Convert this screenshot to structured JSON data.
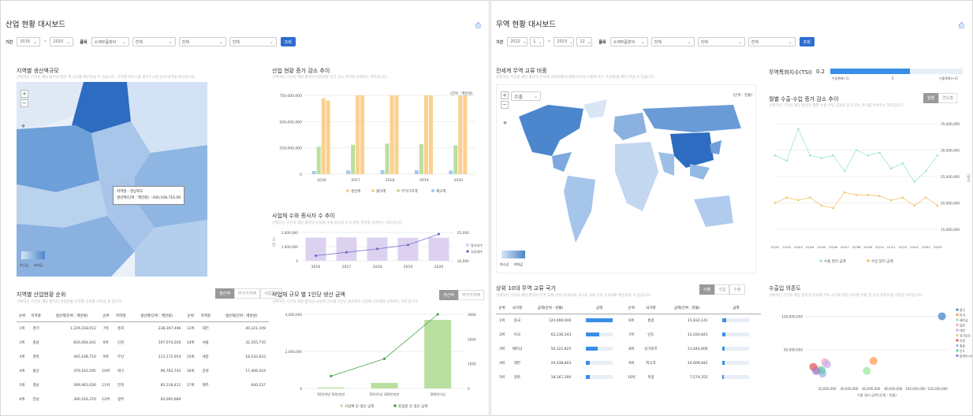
{
  "left": {
    "title": "산업 현황 대시보드",
    "filters": {
      "period_label": "기간",
      "from": "2016",
      "tilde": "~",
      "to": "2020",
      "cat_label": "품목",
      "cat1": "소재부품장비",
      "cat2": "전체",
      "cat3": "전체",
      "cat4": "전체",
      "search": "조회"
    },
    "regional": {
      "title": "지역별 생산액규모",
      "subtitle": "선택하신 기간의 해당 품목의 생산 액 규모를 확인하실 수 있습니다. 지역별 마우스를 올려두시면 상세 내역을 확인합니다.",
      "unit": "(단위 : 백만원)",
      "legend_min": "최소값",
      "legend_max": "최대값",
      "tooltip_region_label": "지역명",
      "tooltip_region": "경상북도",
      "tooltip_value_label": "생산액(단위 : 백만원)",
      "tooltip_value": "440,108,710.00"
    },
    "industry_change": {
      "title": "산업 현황 증가 감소 추이",
      "subtitle": "선택하신 기간의 해당 품목의 산업현황 증가 감소 추이를 보여주는 차트입니다.",
      "legend": [
        "생산액",
        "출하액",
        "부가가치액",
        "재고액"
      ]
    },
    "workers": {
      "title": "사업체 수와 종사자 수 추이",
      "subtitle": "선택하신 기간의 해당 품목의 사업체 수와 종사자 수의 변화 추이를 보여주는 차트입니다.",
      "legend": [
        "종사자수",
        "사업체수"
      ],
      "ylabel_left": "(명 수)",
      "ylabel_right": "(개 수)"
    },
    "ranking": {
      "title": "지역별 산업현황 순위",
      "subtitle": "선택하신 기간의 해당 품목의 산업현황 지역별 순위를 나타낸 표 입니다.",
      "tabs": [
        "생산액",
        "부가가치액",
        "사업체수"
      ],
      "headers": [
        "순위",
        "지역명",
        "생산액(단위 : 백만원)"
      ],
      "col1": [
        [
          "1위",
          "경기",
          "1,229,318,012"
        ],
        [
          "2위",
          "충남",
          "816,064,641"
        ],
        [
          "3위",
          "경북",
          "445,108,710"
        ],
        [
          "4위",
          "울산",
          "379,163,595"
        ],
        [
          "5위",
          "경남",
          "309,963,026"
        ],
        [
          "6위",
          "전남",
          "300,416,376"
        ]
      ],
      "col2": [
        [
          "7위",
          "충북",
          "238,397,496"
        ],
        [
          "8위",
          "인천",
          "197,074,200"
        ],
        [
          "9위",
          "부산",
          "113,172,954"
        ],
        [
          "10위",
          "대구",
          "90,762,745"
        ],
        [
          "11위",
          "전북",
          "85,318,411"
        ],
        [
          "12위",
          "광주",
          "65,095,689"
        ]
      ],
      "col3": [
        [
          "13위",
          "대전",
          "40,321,109"
        ],
        [
          "14위",
          "서울",
          "32,355,735"
        ],
        [
          "15위",
          "세종",
          "18,532,833"
        ],
        [
          "16위",
          "강원",
          "17,406,424"
        ],
        [
          "17위",
          "제주",
          "640,237"
        ]
      ]
    },
    "scale": {
      "title": "사업체 규모 별 1인당 생산 금액",
      "subtitle": "선택하신 기간의 해당 품목의 사업체 규모별 1인당 생산액과 사업체 규모별로 보여주는 차트입니다.",
      "tabs": [
        "생산액",
        "부가가치액"
      ],
      "legend": [
        "사업체 당 생산 금액",
        "종업원 당 생산 금액"
      ]
    },
    "colors": {
      "accent": "#2f6dd0",
      "map_dark": "#2d6cc0",
      "bar_orange": "#fbd08e",
      "bar_green": "#b9df9e",
      "bar_blue": "#a6c8ec",
      "bar_purple": "#dcd2f0",
      "line_purple": "#7d6fd0",
      "line_green": "#44a544"
    }
  },
  "right": {
    "title": "무역 현황 대시보드",
    "filters": {
      "period_label": "기간",
      "from_y": "2022",
      "from_m": "1",
      "tilde": "~",
      "to_y": "2023",
      "to_m": "12",
      "cat_label": "품목",
      "cat1": "소재부품장비",
      "cat2": "전체",
      "cat3": "전체",
      "cat4": "전체",
      "search": "조회"
    },
    "world": {
      "title": "전세계 무역 교류 비중",
      "subtitle": "선택하신 기간의 해당 품목의 전세계 교류현황(전세계 국가의 수출액 또는 수입액)을 확인 하실 수 있습니다.",
      "unit": "(단위 : 천불)",
      "mode": "수출",
      "legend_min": "최소값",
      "legend_max": "최대값"
    },
    "tsi": {
      "title": "무역특화지수(TSI)",
      "value": "0.2",
      "left": "수입특화(-1)",
      "mid": "0",
      "right": "수출특화(+1)",
      "fill_fraction": 0.6
    },
    "monthly": {
      "title": "월별 수출·수입 증가 감소 추이",
      "subtitle": "선택하신 기간의 해당 품목의 월별 수출 수입 금액의 증가 감소 추이를 보여주는 차트입니다.",
      "tabs": [
        "월별",
        "연도별"
      ],
      "legend": [
        "수출 달러 금액",
        "수입 달러 금액"
      ],
      "ylabel": "(달러)"
    },
    "top10": {
      "title": "상위 10대 무역 교류 국가",
      "subtitle": "선택하신 기간의 해당 품목의 무역 교류 상위 10개국을 국가의 교류 규모 순서대로 확인하실 수 있습니다.",
      "tabs": [
        "수출",
        "수입",
        "수출"
      ],
      "headers": [
        "순위",
        "국가명",
        "금액(단위 : 천불)",
        "금액"
      ],
      "col1": [
        [
          "1위",
          "중국",
          "124,006,040"
        ],
        [
          "2위",
          "미국",
          "62,236,343"
        ],
        [
          "3위",
          "베트남",
          "56,321,825"
        ],
        [
          "4위",
          "대만",
          "20,038,803"
        ],
        [
          "5위",
          "일본",
          "18,167,300"
        ]
      ],
      "col2": [
        [
          "6위",
          "홍콩",
          "15,832,141"
        ],
        [
          "7위",
          "인도",
          "15,030,841"
        ],
        [
          "8위",
          "싱가포르",
          "11,644,800"
        ],
        [
          "9위",
          "멕시코",
          "10,609,842"
        ],
        [
          "10위",
          "독일",
          "7,574,355"
        ]
      ],
      "fractions1": [
        1,
        0.5,
        0.45,
        0.16,
        0.15
      ],
      "fractions2": [
        0.13,
        0.12,
        0.09,
        0.085,
        0.06
      ]
    },
    "dependency": {
      "title": "수출입 의존도",
      "subtitle": "선택하신 기간의 해당 품목의 전세계 주요 국가에 대한 국가별 수출 및 수입 의존도를 나타낸 차트입니다.",
      "xlabel": "수출 달러 금액 (단위 : 천불)",
      "legend": [
        "중국",
        "미국",
        "베트남",
        "일본",
        "대만",
        "싱가포르",
        "독일",
        "홍콩",
        "인도",
        "말레이시아"
      ]
    },
    "colors": {
      "accent": "#2f6dd0",
      "export_line": "#9ee6d8",
      "import_line": "#f5c66d"
    }
  },
  "chart_data": [
    {
      "type": "bar",
      "title": "산업 현황 증가 감소 추이",
      "categories": [
        "2016",
        "2017",
        "2018",
        "2019",
        "2020"
      ],
      "ylim": [
        0,
        750000000
      ],
      "yticks": [
        "0",
        "250,000,000",
        "500,000,000",
        "750,000,000"
      ],
      "series": [
        {
          "name": "생산액",
          "values": [
            720000000,
            785000000,
            810000000,
            795000000,
            770000000
          ]
        },
        {
          "name": "출하액",
          "values": [
            700000000,
            770000000,
            800000000,
            785000000,
            755000000
          ]
        },
        {
          "name": "부가가치액",
          "values": [
            260000000,
            280000000,
            290000000,
            285000000,
            275000000
          ]
        },
        {
          "name": "재고액",
          "values": [
            30000000,
            35000000,
            38000000,
            36000000,
            34000000
          ]
        }
      ]
    },
    {
      "type": "bar",
      "title": "사업체 수와 종사자 수 추이",
      "categories": [
        "2016",
        "2017",
        "2018",
        "2019",
        "2020"
      ],
      "ylim": [
        0,
        2000000
      ],
      "yticks": [
        "0",
        "1,000,000",
        "2,000,000"
      ],
      "y2ticks": [
        "20,000",
        "25,000"
      ],
      "series": [
        {
          "name": "종사자수",
          "values": [
            1640000,
            1650000,
            1640000,
            1620000,
            1630000
          ]
        },
        {
          "name": "사업체수",
          "values": [
            20900,
            21500,
            22100,
            22800,
            24700
          ]
        }
      ]
    },
    {
      "type": "bar",
      "title": "사업체 규모 별 1인당 생산 금액",
      "categories": [
        "50인미만 50인미만",
        "50인이상 300인미만",
        "300인이상"
      ],
      "ylim": [
        0,
        4000000
      ],
      "yticks": [
        "0",
        "2,000,000",
        "4,000,000"
      ],
      "y2ticks": [
        "0",
        "1000",
        "2000",
        "3000"
      ],
      "series": [
        {
          "name": "사업체 당 생산 금액",
          "values": [
            50000,
            300000,
            3700000
          ]
        },
        {
          "name": "종업원 당 생산 금액",
          "values": [
            500,
            1200,
            3000
          ]
        }
      ]
    },
    {
      "type": "line",
      "title": "월별 수출·수입 증가 감소 추이",
      "categories": [
        "22/01",
        "22/02",
        "22/03",
        "22/04",
        "22/05",
        "22/06",
        "22/07",
        "22/08",
        "22/09",
        "22/10",
        "22/11",
        "22/12",
        "23/01",
        "23/02",
        "23/03"
      ],
      "ylim": [
        15000000,
        35000000
      ],
      "yticks": [
        "15,000,000",
        "20,000,000",
        "25,000,000",
        "30,000,000",
        "35,000,000"
      ],
      "series": [
        {
          "name": "수출 달러 금액",
          "values": [
            29000000,
            28000000,
            34000000,
            29000000,
            28500000,
            29000000,
            26000000,
            30000000,
            29000000,
            29500000,
            26500000,
            27500000,
            24000000,
            26000000,
            29000000
          ]
        },
        {
          "name": "수입 달러 금액",
          "values": [
            20000000,
            21000000,
            20500000,
            21000000,
            19500000,
            19000000,
            22000000,
            21500000,
            21500000,
            21300000,
            20500000,
            21000000,
            19500000,
            21000000,
            19500000
          ]
        }
      ]
    },
    {
      "type": "scatter",
      "title": "수출입 의존도",
      "xlabel": "수출 달러 금액 (단위 : 천불)",
      "xticks": [
        "20,000,000",
        "40,000,000",
        "60,000,000",
        "80,000,000",
        "100,000,000",
        "120,000,000"
      ],
      "yticks": [
        "50,000,000",
        "100,000,000"
      ],
      "points": [
        {
          "name": "중국",
          "x": 124000000,
          "y": 100000000
        },
        {
          "name": "미국",
          "x": 62000000,
          "y": 33000000
        },
        {
          "name": "베트남",
          "x": 56000000,
          "y": 18000000
        },
        {
          "name": "일본",
          "x": 18000000,
          "y": 31000000
        },
        {
          "name": "대만",
          "x": 20000000,
          "y": 28000000
        },
        {
          "name": "싱가포르",
          "x": 11600000,
          "y": 20000000
        },
        {
          "name": "독일",
          "x": 7500000,
          "y": 24000000
        },
        {
          "name": "홍콩",
          "x": 15800000,
          "y": 14000000
        },
        {
          "name": "인도",
          "x": 15000000,
          "y": 19000000
        },
        {
          "name": "말레이시아",
          "x": 10000000,
          "y": 18000000
        }
      ]
    }
  ]
}
